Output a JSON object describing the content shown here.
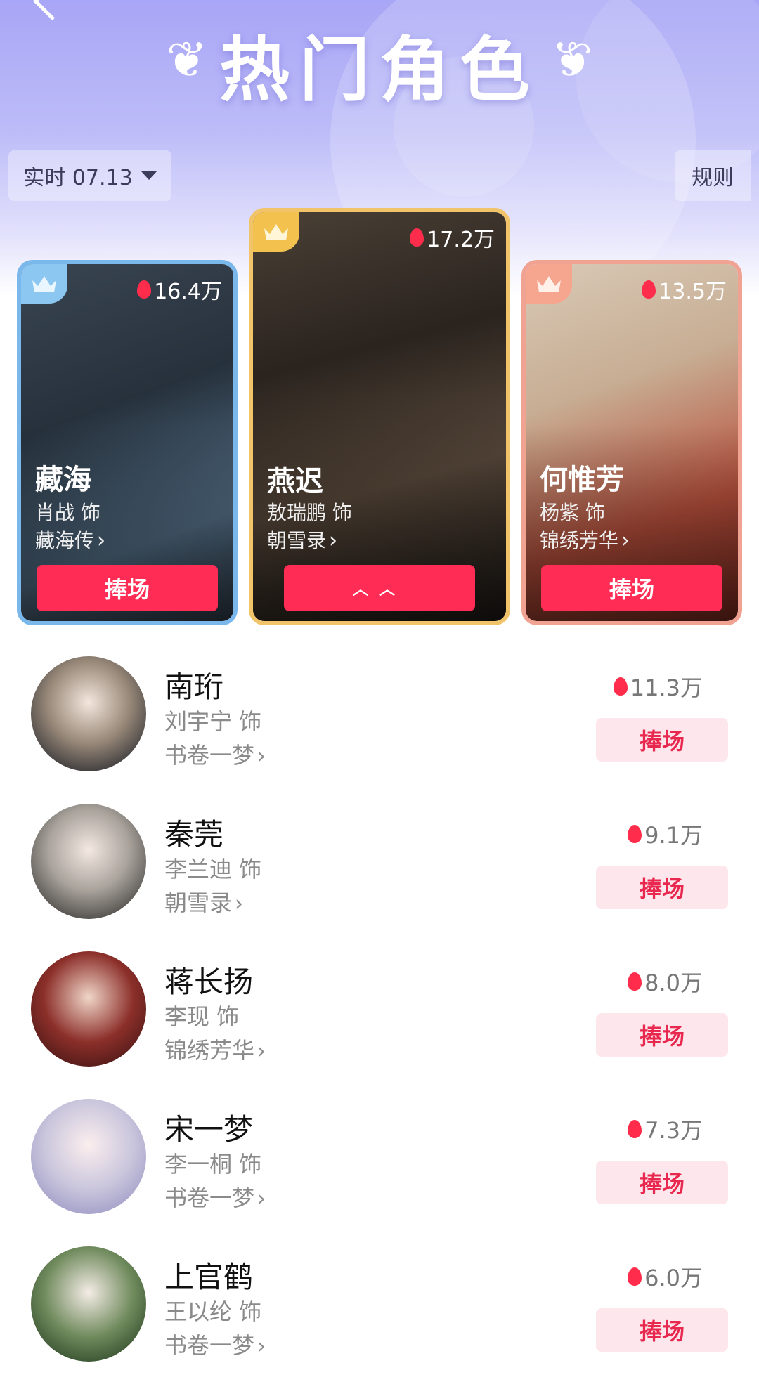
{
  "header": {
    "title": "热门角色",
    "date_label": "实时 07.13",
    "rules_label": "规则"
  },
  "top_cards": [
    {
      "rank": 2,
      "role": "藏海",
      "actor": "肖战 饰",
      "drama": "藏海传",
      "heat": "16.4万",
      "cheer_label": "捧场",
      "accent": "#7ab8ec"
    },
    {
      "rank": 1,
      "role": "燕迟",
      "actor": "敖瑞鹏 饰",
      "drama": "朝雪录",
      "heat": "17.2万",
      "cheer_label": "",
      "accent": "#f2c46a"
    },
    {
      "rank": 3,
      "role": "何惟芳",
      "actor": "杨紫 饰",
      "drama": "锦绣芳华",
      "heat": "13.5万",
      "cheer_label": "捧场",
      "accent": "#f0a393"
    }
  ],
  "list": [
    {
      "name": "南珩",
      "actor": "刘宇宁 饰",
      "drama": "书卷一梦",
      "heat": "11.3万",
      "cheer_label": "捧场"
    },
    {
      "name": "秦莞",
      "actor": "李兰迪 饰",
      "drama": "朝雪录",
      "heat": "9.1万",
      "cheer_label": "捧场"
    },
    {
      "name": "蒋长扬",
      "actor": "李现 饰",
      "drama": "锦绣芳华",
      "heat": "8.0万",
      "cheer_label": "捧场"
    },
    {
      "name": "宋一梦",
      "actor": "李一桐 饰",
      "drama": "书卷一梦",
      "heat": "7.3万",
      "cheer_label": "捧场"
    },
    {
      "name": "上官鹤",
      "actor": "王以纶 饰",
      "drama": "书卷一梦",
      "heat": "6.0万",
      "cheer_label": "捧场"
    }
  ],
  "icons": {
    "flame": "flame-icon",
    "crown": "crown-icon",
    "chevron": "chevron-right-icon",
    "caret": "caret-down-icon"
  },
  "colors": {
    "primary": "#ff2d55",
    "hero": "#a8a6f6",
    "cheer_soft_bg": "#fde7ec",
    "cheer_soft_text": "#e8284f"
  }
}
